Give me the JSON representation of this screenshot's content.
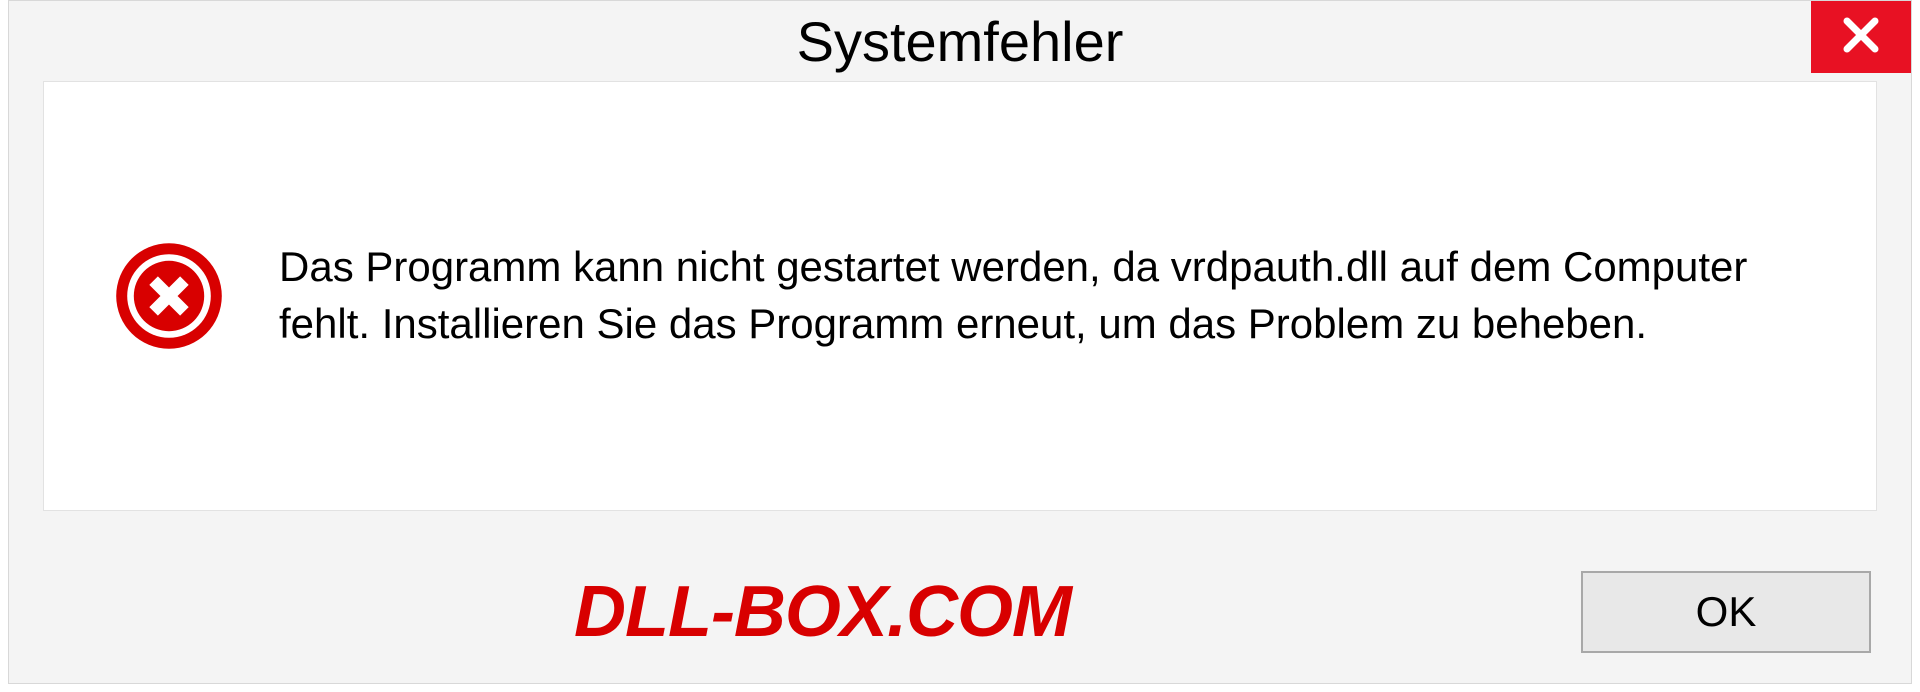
{
  "dialog": {
    "title": "Systemfehler",
    "message": "Das Programm kann nicht gestartet werden, da vrdpauth.dll auf dem Computer fehlt. Installieren Sie das Programm erneut, um das Problem zu beheben.",
    "ok_label": "OK"
  },
  "watermark": "DLL-BOX.COM",
  "colors": {
    "close_bg": "#e81123",
    "error_icon": "#d80000",
    "watermark": "#d80000"
  }
}
